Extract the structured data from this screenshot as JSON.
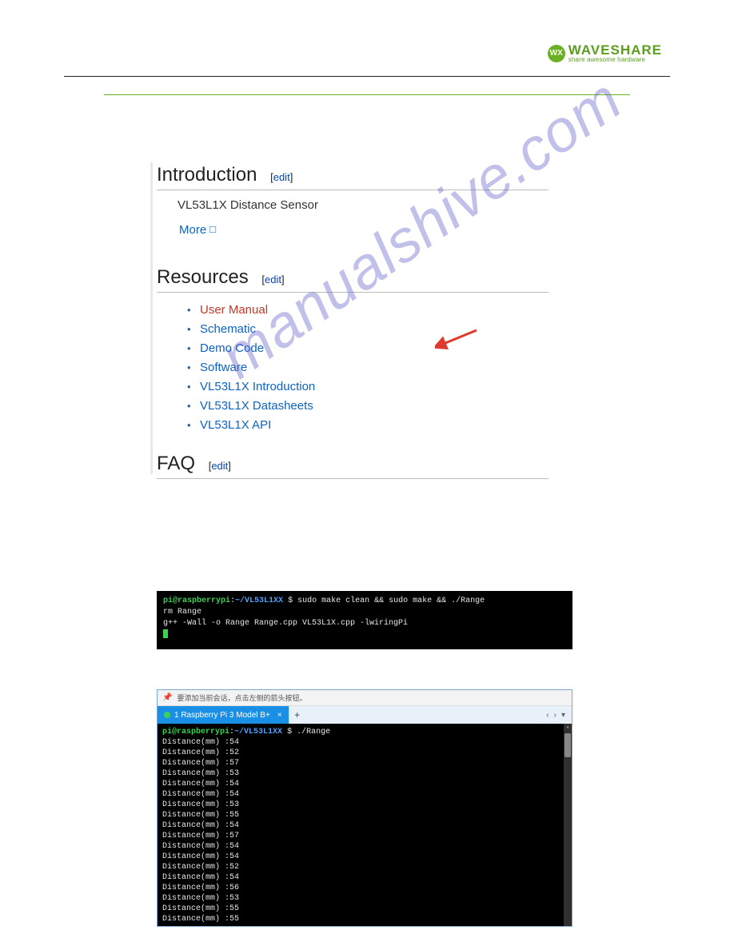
{
  "logo": {
    "badge": "WX",
    "main": "WAVESHARE",
    "sub": "share awesome hardware"
  },
  "wiki": {
    "intro_heading": "Introduction",
    "edit_label": "edit",
    "intro_sub": "VL53L1X Distance Sensor",
    "more_label": "More",
    "resources_heading": "Resources",
    "resources": [
      "User Manual",
      "Schematic",
      "Demo Code",
      "Software",
      "VL53L1X Introduction",
      "VL53L1X Datasheets",
      "VL53L1X API"
    ],
    "faq_heading": "FAQ"
  },
  "terminal1": {
    "user_host": "pi@raspberrypi",
    "path": "~/VL53L1XX",
    "prompt": "$",
    "cmd": "sudo make clean && sudo make && ./Range",
    "line2": "rm Range",
    "line3": "g++ -Wall -o Range Range.cpp VL53L1X.cpp -lwiringPi"
  },
  "terminal2": {
    "toolbar_hint": "要添加当前会话，点击左侧的箭头按钮。",
    "tab_title": "1 Raspberry Pi 3 Model B+",
    "user_host": "pi@raspberrypi",
    "path": "~/VL53L1XX",
    "prompt": "$",
    "cmd": "./Range",
    "distances": [
      54,
      52,
      57,
      53,
      54,
      54,
      53,
      55,
      54,
      57,
      54,
      54,
      52,
      54,
      56,
      53,
      55,
      55
    ],
    "dist_label": "Distance(mm) :"
  },
  "watermark": "manualshive.com"
}
